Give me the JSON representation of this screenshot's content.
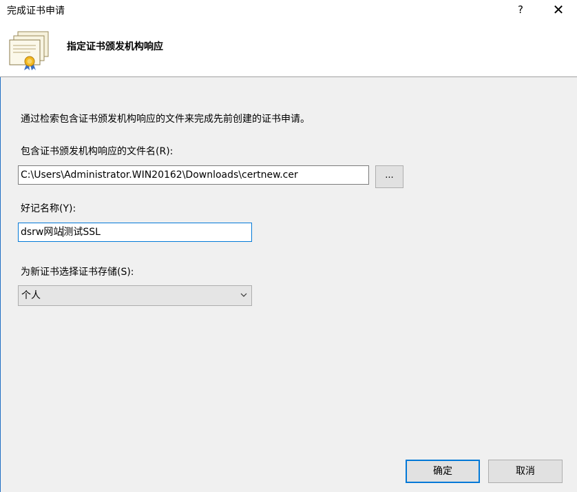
{
  "window": {
    "title": "完成证书申请",
    "help_glyph": "?",
    "close_glyph": "✕"
  },
  "header": {
    "title": "指定证书颁发机构响应",
    "icon": "certificate-icon"
  },
  "description": "通过检索包含证书颁发机构响应的文件来完成先前创建的证书申请。",
  "file_field": {
    "label": "包含证书颁发机构响应的文件名(R):",
    "value": "C:\\Users\\Administrator.WIN20162\\Downloads\\certnew.cer",
    "browse_label": "..."
  },
  "friendly_name": {
    "label": "好记名称(Y):",
    "value_before_caret": "dsrw网站",
    "value_after_caret": "测试SSL"
  },
  "store": {
    "label": "为新证书选择证书存储(S):",
    "selected": "个人",
    "icon": "chevron-down-icon"
  },
  "buttons": {
    "ok": "确定",
    "cancel": "取消"
  },
  "colors": {
    "accent": "#0078d7",
    "panel": "#f0f0f0",
    "button": "#e1e1e1"
  }
}
